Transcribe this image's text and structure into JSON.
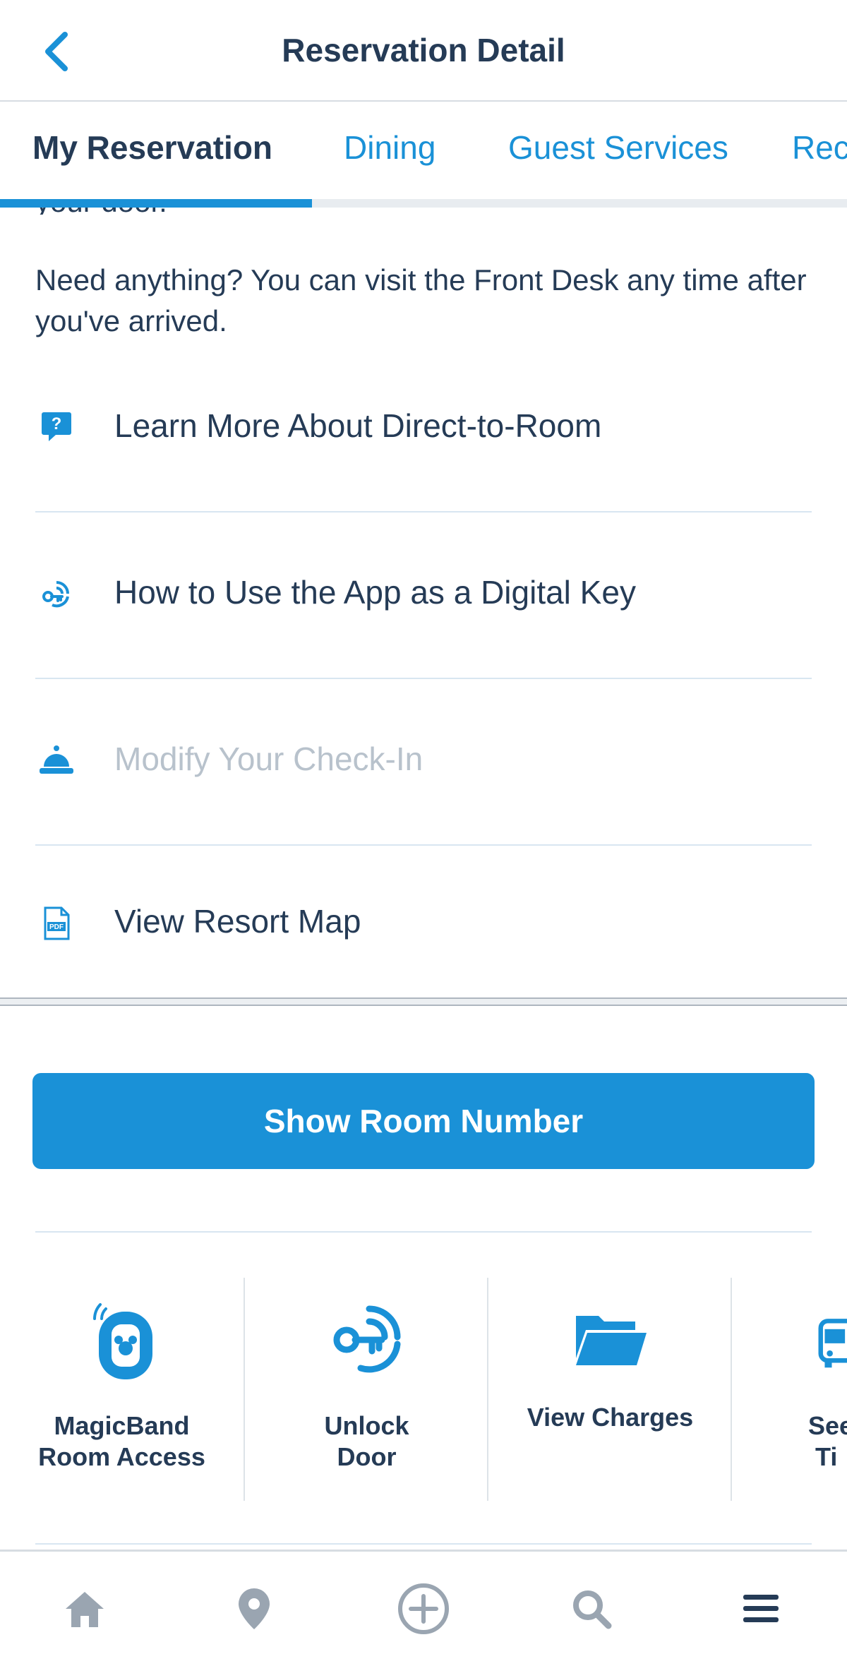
{
  "header": {
    "title": "Reservation Detail",
    "back_icon": "chevron-left-icon"
  },
  "tabs": [
    {
      "label": "My Reservation",
      "active": true
    },
    {
      "label": "Dining",
      "active": false
    },
    {
      "label": "Guest Services",
      "active": false
    },
    {
      "label": "Rec",
      "active": false
    }
  ],
  "content": {
    "cut_off_text": "your door.",
    "intro": "Need anything? You can visit the Front Desk any time after you've arrived.",
    "links": [
      {
        "label": "Learn More About Direct-to-Room",
        "icon": "question-bubble-icon",
        "disabled": false
      },
      {
        "label": "How to Use the App as a Digital Key",
        "icon": "digital-key-icon",
        "disabled": false
      },
      {
        "label": "Modify Your Check-In",
        "icon": "bell-icon",
        "disabled": true
      },
      {
        "label": "View Resort Map",
        "icon": "pdf-icon",
        "disabled": false
      }
    ]
  },
  "primary_button": {
    "label": "Show Room Number"
  },
  "quick_actions": [
    {
      "label": "MagicBand\nRoom Access",
      "icon": "magicband-icon"
    },
    {
      "label": "Unlock\nDoor",
      "icon": "digital-key-icon"
    },
    {
      "label": "View Charges",
      "icon": "folder-icon"
    },
    {
      "label": "See\nTi",
      "icon": "bus-icon"
    }
  ],
  "bottom_nav": [
    {
      "name": "home",
      "icon": "home-icon"
    },
    {
      "name": "map",
      "icon": "map-pin-icon"
    },
    {
      "name": "add",
      "icon": "plus-circle-icon"
    },
    {
      "name": "search",
      "icon": "search-icon"
    },
    {
      "name": "menu",
      "icon": "menu-icon",
      "active": true
    }
  ],
  "colors": {
    "accent": "#1a91d7",
    "text": "#253b56",
    "disabled": "#b8c2cc",
    "nav_icon": "#9aa5b1"
  }
}
